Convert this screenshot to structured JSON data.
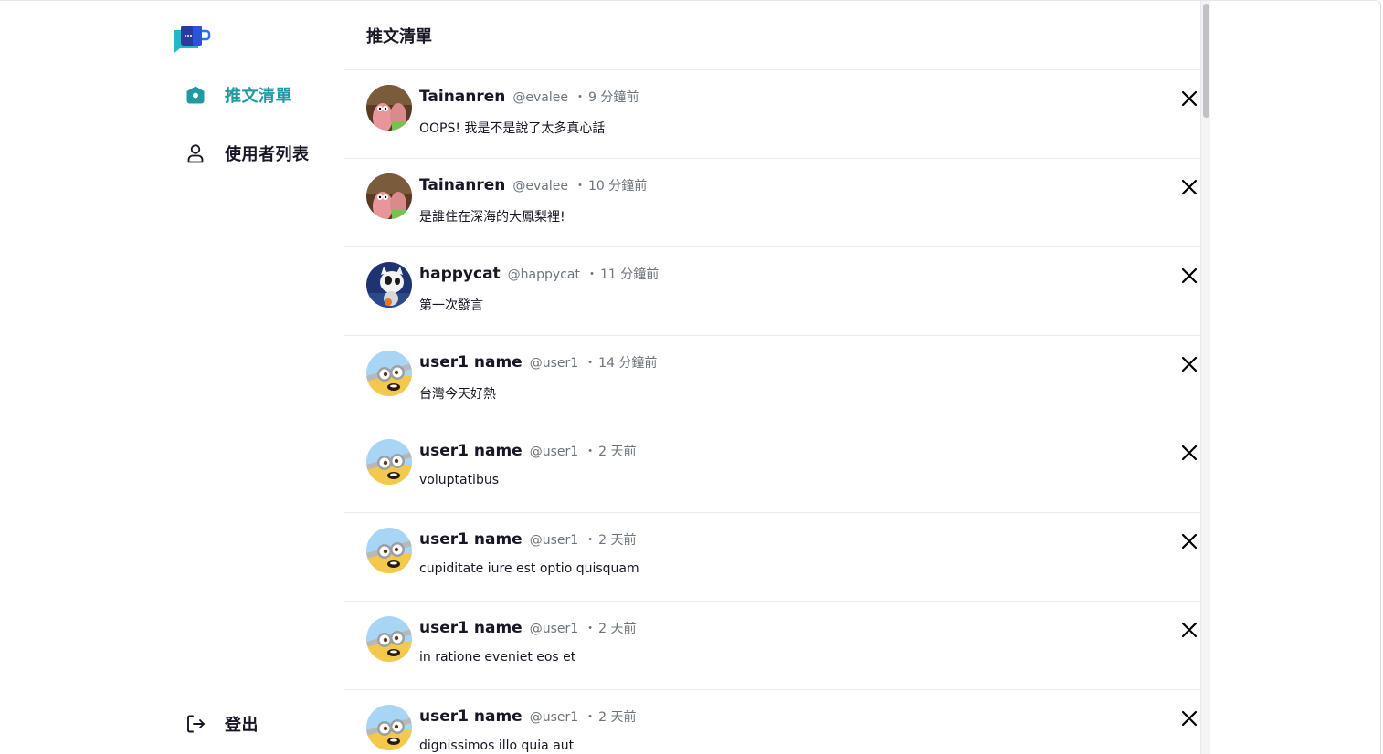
{
  "sidebar": {
    "nav": {
      "home_label": "推文清單",
      "users_label": "使用者列表",
      "logout_label": "登出"
    },
    "accent_color": "#1f9aa0"
  },
  "header": {
    "title": "推文清單"
  },
  "tweets": [
    {
      "name": "Tainanren",
      "handle": "@evalee",
      "dot": "・",
      "time": "9 分鐘前",
      "text": "OOPS! 我是不是說了太多真心話",
      "avatar": "patrick-avatar"
    },
    {
      "name": "Tainanren",
      "handle": "@evalee",
      "dot": "・",
      "time": "10 分鐘前",
      "text": "是誰住在深海的大鳳梨裡!",
      "avatar": "patrick-avatar"
    },
    {
      "name": "happycat",
      "handle": "@happycat",
      "dot": "・",
      "time": "11 分鐘前",
      "text": "第一次發言",
      "avatar": "cat-avatar"
    },
    {
      "name": "user1 name",
      "handle": "@user1",
      "dot": "・",
      "time": "14 分鐘前",
      "text": "台灣今天好熱",
      "avatar": "minion-avatar"
    },
    {
      "name": "user1 name",
      "handle": "@user1",
      "dot": "・",
      "time": "2 天前",
      "text": "voluptatibus",
      "avatar": "minion-avatar"
    },
    {
      "name": "user1 name",
      "handle": "@user1",
      "dot": "・",
      "time": "2 天前",
      "text": "cupiditate iure est optio quisquam",
      "avatar": "minion-avatar"
    },
    {
      "name": "user1 name",
      "handle": "@user1",
      "dot": "・",
      "time": "2 天前",
      "text": "in ratione eveniet eos et",
      "avatar": "minion-avatar"
    },
    {
      "name": "user1 name",
      "handle": "@user1",
      "dot": "・",
      "time": "2 天前",
      "text": "dignissimos illo quia aut",
      "avatar": "minion-avatar"
    }
  ]
}
